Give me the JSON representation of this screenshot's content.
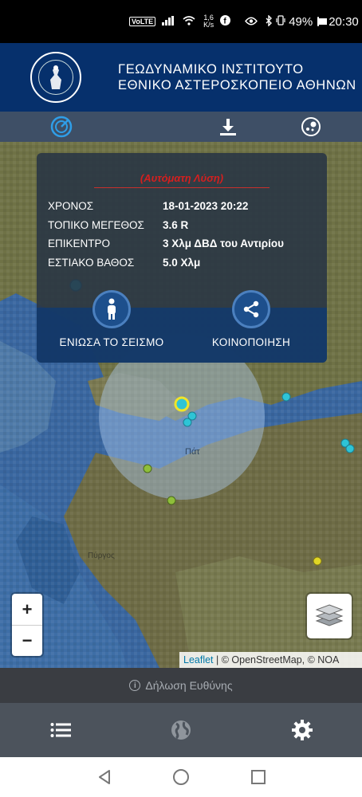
{
  "status_bar": {
    "volte": "VoLTE",
    "speed": "1,6\nK/s",
    "battery_pct": "49%",
    "battery_level": 0.49,
    "time": "20:30"
  },
  "header": {
    "title_line1": "ΓΕΩΔΥΝΑΜΙΚΟ ΙΝΣΤΙΤΟΥΤΟ",
    "title_line2": "ΕΘΝΙΚΟ ΑΣΤΕΡΟΣΚΟΠΕΙΟ ΑΘΗΝΩΝ"
  },
  "toolbar": {
    "icons": [
      "radar-icon",
      "download-icon",
      "settings-globe-icon"
    ]
  },
  "event": {
    "auto_label": "(Αυτόματη Λύση)",
    "rows": [
      {
        "label": "ΧΡΟΝΟΣ",
        "value": "18-01-2023 20:22"
      },
      {
        "label": "ΤΟΠΙΚΟ ΜΕΓΕΘΟΣ",
        "value": "3.6 R"
      },
      {
        "label": "ΕΠΙΚΕΝΤΡΟ",
        "value": "3 Χλμ ΔΒΔ του Αντιρίου"
      },
      {
        "label": "ΕΣΤΙΑΚΟ ΒΑΘΟΣ",
        "value": "5.0 Χλμ"
      }
    ],
    "felt_label": "ΕΝΙΩΣΑ ΤΟ ΣΕΙΣΜΟ",
    "share_label": "ΚΟΙΝΟΠΟΙΗΣΗ"
  },
  "map": {
    "zoom_in": "+",
    "zoom_out": "−",
    "place_label_patras": "Πάτ",
    "place_label_pyrgos": "Πύργος",
    "attribution_leaflet": "Leaflet",
    "attribution_rest": " | © OpenStreetMap, © NOA",
    "colors": {
      "recent": "#2ec4d6",
      "older": "#8fbf3a",
      "selected_ring": "#f0e428"
    }
  },
  "disclaimer": {
    "text": "Δήλωση Ευθύνης"
  },
  "bottom_nav": {
    "icons": [
      "list-icon",
      "globe-icon",
      "gear-icon"
    ]
  }
}
